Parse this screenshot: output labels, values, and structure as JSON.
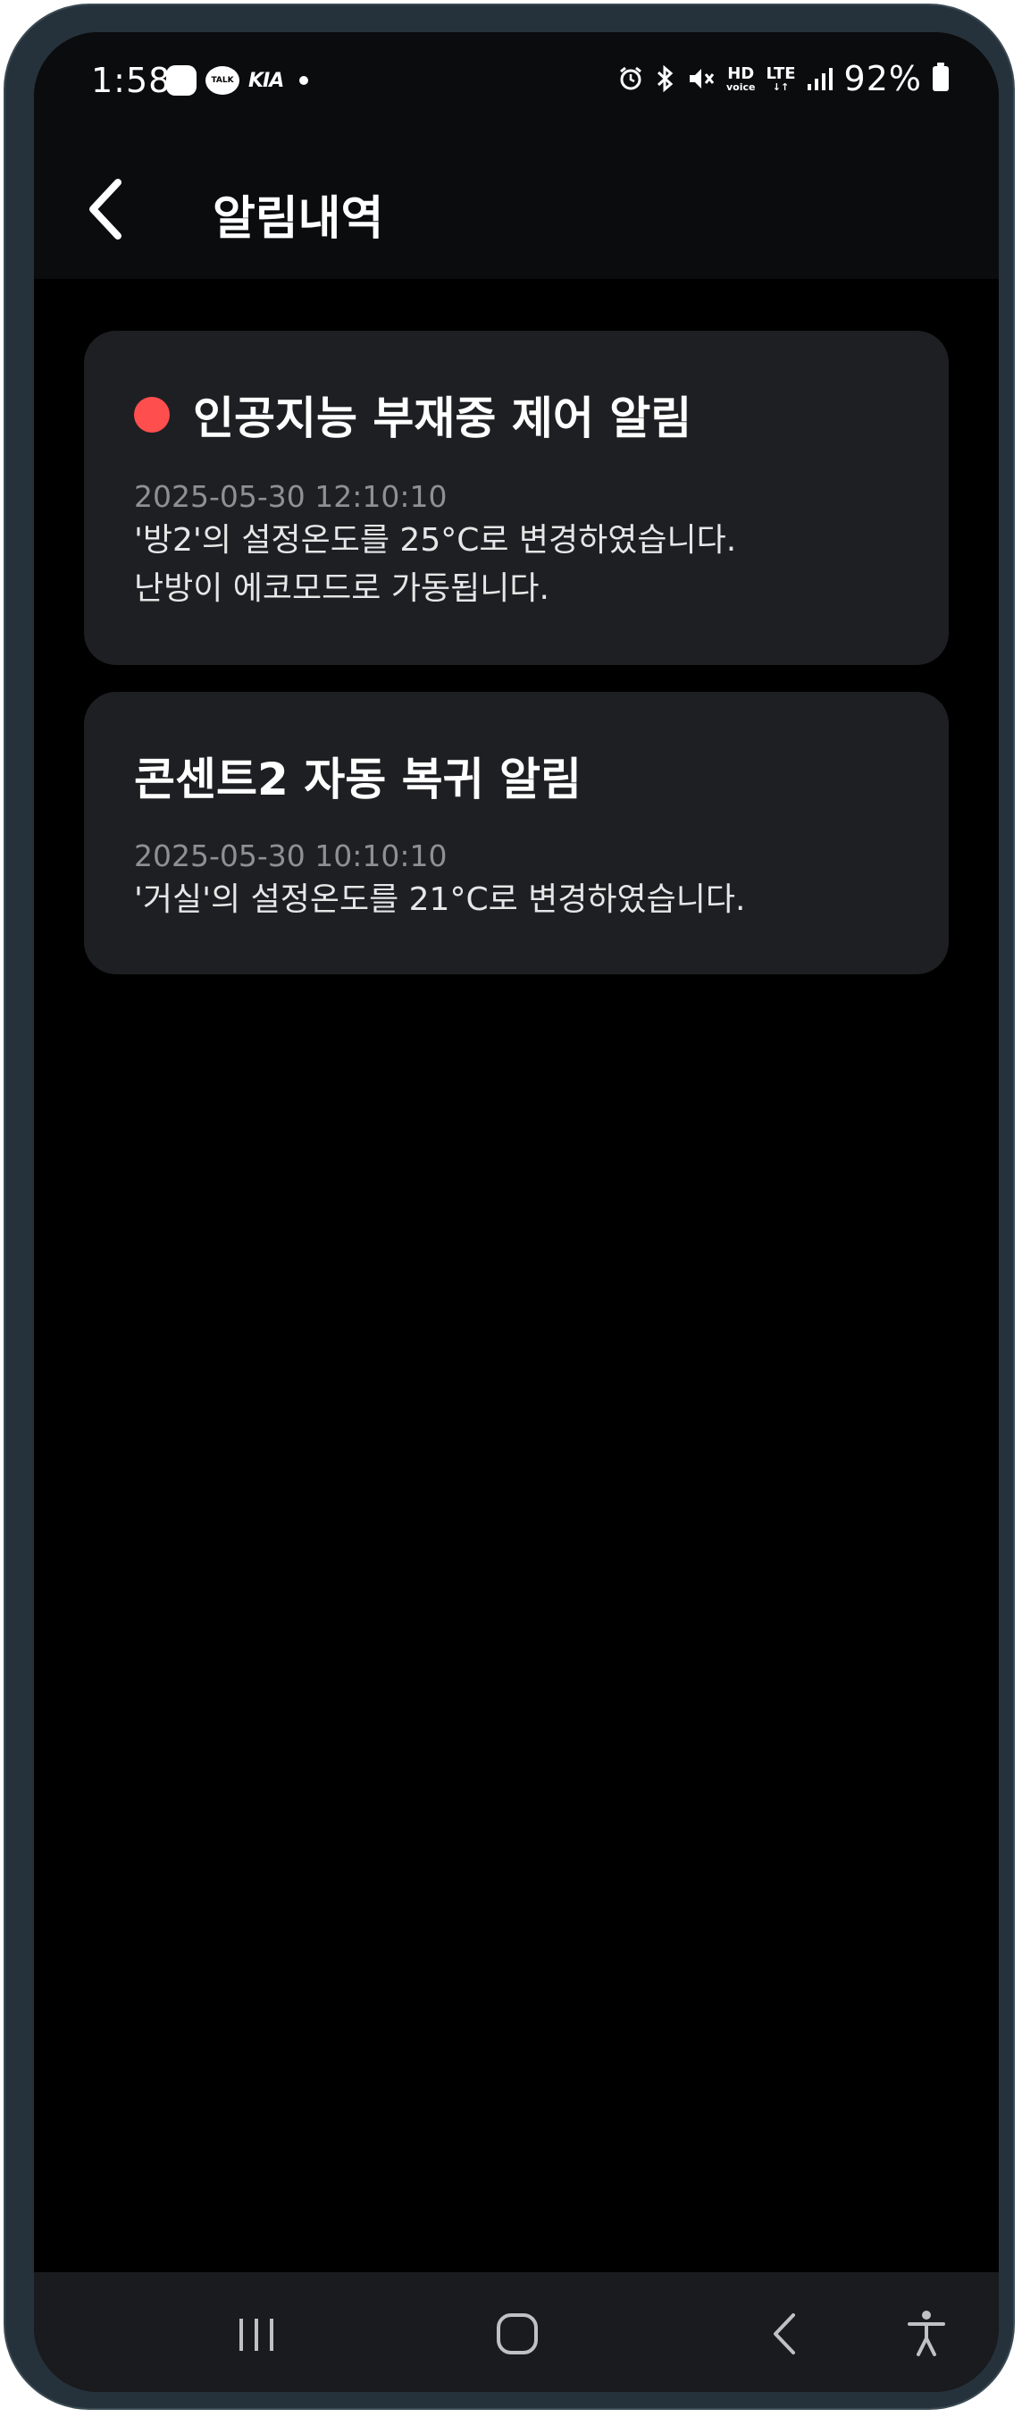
{
  "status_bar": {
    "time": "1:58",
    "talk_label": "TALK",
    "carrier_logo": "KIA",
    "hd_label": "HD",
    "hd_sub": "voice",
    "lte_label": "LTE",
    "battery": "92%"
  },
  "appbar": {
    "title": "알림내역"
  },
  "notifications": [
    {
      "title": "인공지능 부재중 제어 알림",
      "unread": true,
      "time": "2025-05-30 12:10:10",
      "lines": [
        "'방2'의 설정온도를 25°C로 변경하였습니다.",
        "난방이 에코모드로 가동됩니다."
      ]
    },
    {
      "title": "콘센트2 자동 복귀 알림",
      "unread": false,
      "time": "2025-05-30 10:10:10",
      "lines": [
        "'거실'의 설정온도를 21°C로 변경하였습니다."
      ]
    }
  ],
  "colors": {
    "unread_dot": "#ff4e4e",
    "card_bg": "#1e1f23",
    "background": "#000000"
  },
  "icons": {
    "back": "chevron-left-icon",
    "nav_recent": "recent-apps-icon",
    "nav_home": "home-icon",
    "nav_back": "back-icon",
    "nav_access": "accessibility-icon"
  }
}
